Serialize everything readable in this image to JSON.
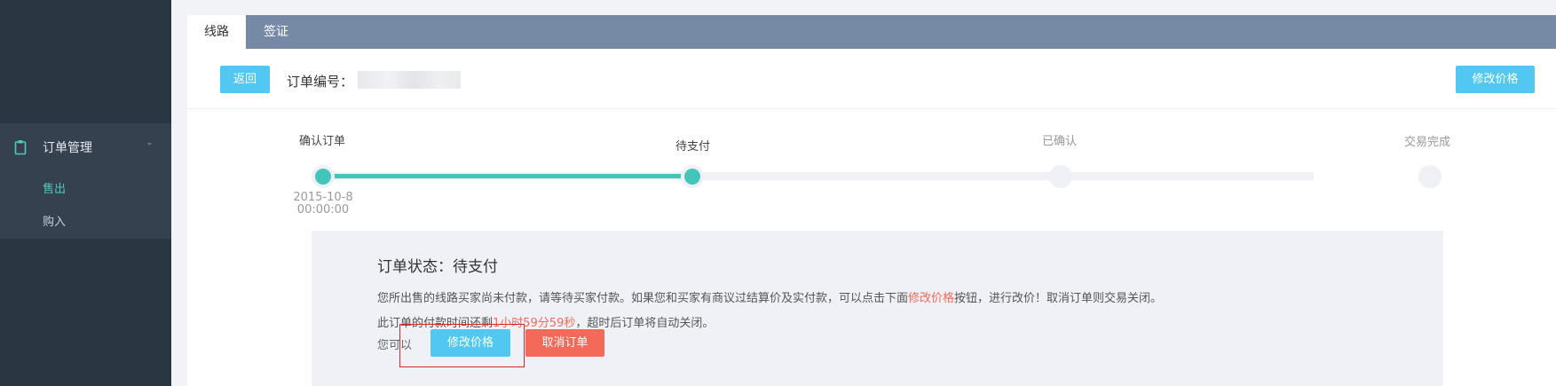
{
  "sidebar": {
    "group": {
      "icon": "clipboard-icon",
      "label": "订单管理",
      "collapse_symbol": "-",
      "items": [
        {
          "label": "售出",
          "active": true
        },
        {
          "label": "购入",
          "active": false
        }
      ]
    }
  },
  "tabs": [
    {
      "label": "线路",
      "active": true
    },
    {
      "label": "签证",
      "active": false
    }
  ],
  "toolbar": {
    "back_label": "返回",
    "order_no_label": "订单编号：",
    "edit_price_label": "修改价格"
  },
  "steps": [
    {
      "label": "确认订单",
      "time_line1": "2015-10-8",
      "time_line2": "00:00:00",
      "done": true
    },
    {
      "label": "待支付",
      "done": true
    },
    {
      "label": "已确认",
      "done": false
    },
    {
      "label": "交易完成",
      "done": false
    }
  ],
  "status": {
    "title": "订单状态：待支付",
    "line1_pre": "您所出售的线路买家尚未付款，请等待买家付款。如果您和买家有商议过结算价及实付款，可以点击下面",
    "line1_highlight": "修改价格",
    "line1_post": "按钮，进行改价！取消订单则交易关闭。",
    "line2_pre": "此订单的付款时间还剩",
    "line2_countdown": "1小时59分59秒",
    "line2_post": "，超时后订单将自动关闭。",
    "you_can": "您可以",
    "edit_price_label": "修改价格",
    "cancel_label": "取消订单"
  },
  "colors": {
    "accent_blue": "#52c8f1",
    "accent_teal": "#44c5b9",
    "danger": "#f36a5a",
    "sidebar_bg": "#2b3643",
    "tabbar_bg": "#768aa6"
  }
}
